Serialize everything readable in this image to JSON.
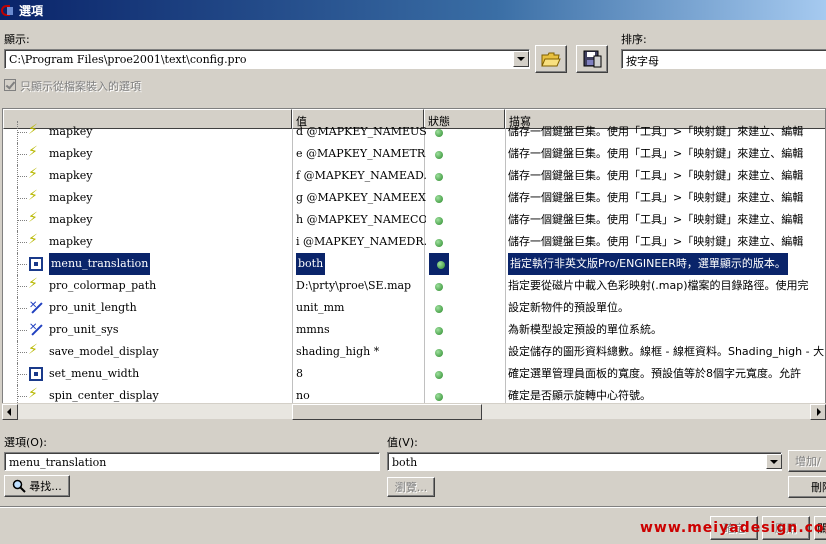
{
  "window": {
    "title": "選項"
  },
  "display": {
    "label": "顯示:",
    "path": "C:\\Program Files\\proe2001\\text\\config.pro"
  },
  "sort": {
    "label": "排序:",
    "value": "按字母"
  },
  "filter_checkbox": {
    "label": "只顯示從檔案裝入的選項",
    "checked": true,
    "enabled": false
  },
  "columns": [
    "",
    "值",
    "狀態",
    "描寫"
  ],
  "rows": [
    {
      "icon": "bolt-icon",
      "name": "mapkey",
      "value": "d @MAPKEY_NAMEUS...",
      "desc": "儲存一個鍵盤巨集。使用「工具」>「映射鍵」來建立、編輯",
      "selected": false
    },
    {
      "icon": "bolt-icon",
      "name": "mapkey",
      "value": "e @MAPKEY_NAMETR...",
      "desc": "儲存一個鍵盤巨集。使用「工具」>「映射鍵」來建立、編輯",
      "selected": false
    },
    {
      "icon": "bolt-icon",
      "name": "mapkey",
      "value": "f @MAPKEY_NAMEAD...",
      "desc": "儲存一個鍵盤巨集。使用「工具」>「映射鍵」來建立、編輯",
      "selected": false
    },
    {
      "icon": "bolt-icon",
      "name": "mapkey",
      "value": "g @MAPKEY_NAMEEX...",
      "desc": "儲存一個鍵盤巨集。使用「工具」>「映射鍵」來建立、編輯",
      "selected": false
    },
    {
      "icon": "bolt-icon",
      "name": "mapkey",
      "value": "h @MAPKEY_NAMECO...",
      "desc": "儲存一個鍵盤巨集。使用「工具」>「映射鍵」來建立、編輯",
      "selected": false
    },
    {
      "icon": "bolt-icon",
      "name": "mapkey",
      "value": "i @MAPKEY_NAMEDR...",
      "desc": "儲存一個鍵盤巨集。使用「工具」>「映射鍵」來建立、編輯",
      "selected": false
    },
    {
      "icon": "box-icon",
      "name": "menu_translation",
      "value": "both",
      "desc": "指定執行非英文版Pro/ENGINEER時，選單顯示的版本。",
      "selected": true
    },
    {
      "icon": "bolt-icon",
      "name": "pro_colormap_path",
      "value": "D:\\prty\\proe\\SE.map",
      "desc": "指定要從磁片中載入色彩映射(.map)檔案的目錄路徑。使用完",
      "selected": false
    },
    {
      "icon": "ruler-icon",
      "name": "pro_unit_length",
      "value": "unit_mm",
      "desc": "設定新物件的預設單位。",
      "selected": false
    },
    {
      "icon": "ruler-icon",
      "name": "pro_unit_sys",
      "value": "mmns",
      "desc": "為新模型設定預設的單位系統。",
      "selected": false
    },
    {
      "icon": "bolt-icon",
      "name": "save_model_display",
      "value": "shading_high *",
      "desc": "設定儲存的圖形資料總數。線框 - 線框資料。Shading_high - 大",
      "selected": false
    },
    {
      "icon": "box-icon",
      "name": "set_menu_width",
      "value": "8",
      "desc": "確定選單管理員面板的寬度。預設值等於8個字元寬度。允許",
      "selected": false
    },
    {
      "icon": "bolt-icon",
      "name": "spin_center_display",
      "value": "no",
      "desc": "確定是否顯示旋轉中心符號。",
      "selected": false
    }
  ],
  "option": {
    "label": "選項(O):",
    "value": "menu_translation"
  },
  "value_field": {
    "label": "值(V):",
    "value": "both"
  },
  "buttons": {
    "find": "尋找...",
    "browse": "瀏覽...",
    "add_change": "增加/",
    "delete": "刪除",
    "apply": "確定",
    "cancel": "應用",
    "close": "關"
  },
  "watermark": "www.meiyadesign.com"
}
